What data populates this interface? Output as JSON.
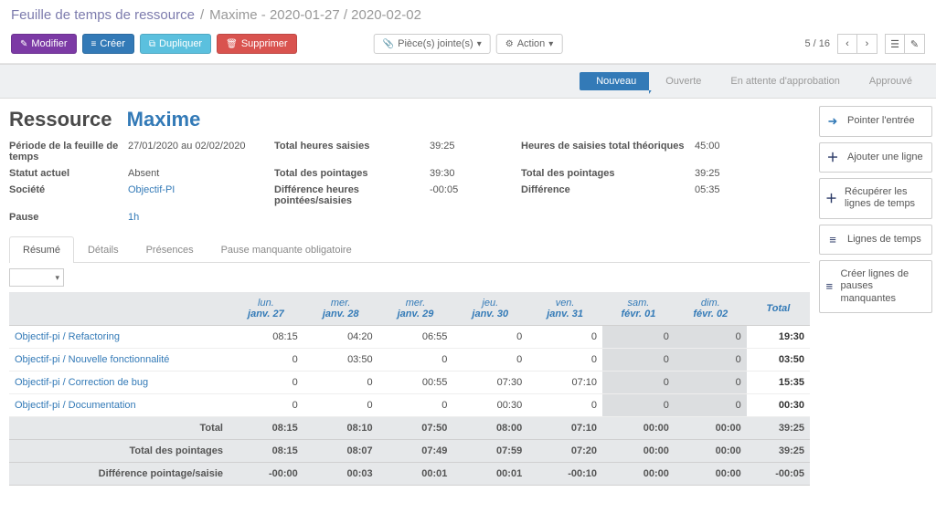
{
  "breadcrumb": {
    "root": "Feuille de temps de ressource",
    "sep": "/",
    "current": "Maxime - 2020-01-27 / 2020-02-02"
  },
  "toolbar": {
    "modify": "Modifier",
    "create": "Créer",
    "duplicate": "Dupliquer",
    "delete": "Supprimer",
    "attachments": "Pièce(s) jointe(s)",
    "action": "Action"
  },
  "pager": {
    "text": "5 / 16"
  },
  "status": {
    "nouveau": "Nouveau",
    "ouverte": "Ouverte",
    "attente": "En attente d'approbation",
    "approuve": "Approuvé"
  },
  "header": {
    "ressource_label": "Ressource",
    "name": "Maxime"
  },
  "fields": {
    "period_l": "Période de la feuille de temps",
    "period_v": "27/01/2020 au 02/02/2020",
    "statut_l": "Statut actuel",
    "statut_v": "Absent",
    "societe_l": "Société",
    "societe_v": "Objectif-PI",
    "pause_l": "Pause",
    "pause_v": "1h",
    "ths_l": "Total heures saisies",
    "ths_v": "39:25",
    "tdp_l": "Total des pointages",
    "tdp_v": "39:30",
    "diff_l": "Différence heures pointées/saisies",
    "diff_v": "-00:05",
    "htheo_l": "Heures de saisies total théoriques",
    "htheo_v": "45:00",
    "tdp2_l": "Total des pointages",
    "tdp2_v": "39:25",
    "diff2_l": "Différence",
    "diff2_v": "05:35"
  },
  "tabs": {
    "resume": "Résumé",
    "details": "Détails",
    "presences": "Présences",
    "pause": "Pause manquante obligatoire"
  },
  "sidebar": {
    "pointer": "Pointer l'entrée",
    "ajouter": "Ajouter une ligne",
    "recuperer": "Récupérer les lignes de temps",
    "lignes": "Lignes de temps",
    "creer": "Créer lignes de pauses manquantes"
  },
  "days": [
    {
      "d1": "lun.",
      "d2": "janv. 27"
    },
    {
      "d1": "mer.",
      "d2": "janv. 28"
    },
    {
      "d1": "mer.",
      "d2": "janv. 29"
    },
    {
      "d1": "jeu.",
      "d2": "janv. 30"
    },
    {
      "d1": "ven.",
      "d2": "janv. 31"
    },
    {
      "d1": "sam.",
      "d2": "févr. 01"
    },
    {
      "d1": "dim.",
      "d2": "févr. 02"
    }
  ],
  "total_h": "Total",
  "rows": [
    {
      "label": "Objectif-pi / Refactoring",
      "cells": [
        "08:15",
        "04:20",
        "06:55",
        "0",
        "0",
        "0",
        "0"
      ],
      "total": "19:30"
    },
    {
      "label": "Objectif-pi / Nouvelle fonctionnalité",
      "cells": [
        "0",
        "03:50",
        "0",
        "0",
        "0",
        "0",
        "0"
      ],
      "total": "03:50"
    },
    {
      "label": "Objectif-pi / Correction de bug",
      "cells": [
        "0",
        "0",
        "00:55",
        "07:30",
        "07:10",
        "0",
        "0"
      ],
      "total": "15:35"
    },
    {
      "label": "Objectif-pi / Documentation",
      "cells": [
        "0",
        "0",
        "0",
        "00:30",
        "0",
        "0",
        "0"
      ],
      "total": "00:30"
    }
  ],
  "totals": [
    {
      "label": "Total",
      "cells": [
        "08:15",
        "08:10",
        "07:50",
        "08:00",
        "07:10",
        "00:00",
        "00:00"
      ],
      "total": "39:25"
    },
    {
      "label": "Total des pointages",
      "cells": [
        "08:15",
        "08:07",
        "07:49",
        "07:59",
        "07:20",
        "00:00",
        "00:00"
      ],
      "total": "39:25"
    },
    {
      "label": "Différence pointage/saisie",
      "cells": [
        "-00:00",
        "00:03",
        "00:01",
        "00:01",
        "-00:10",
        "00:00",
        "00:00"
      ],
      "total": "-00:05"
    }
  ]
}
